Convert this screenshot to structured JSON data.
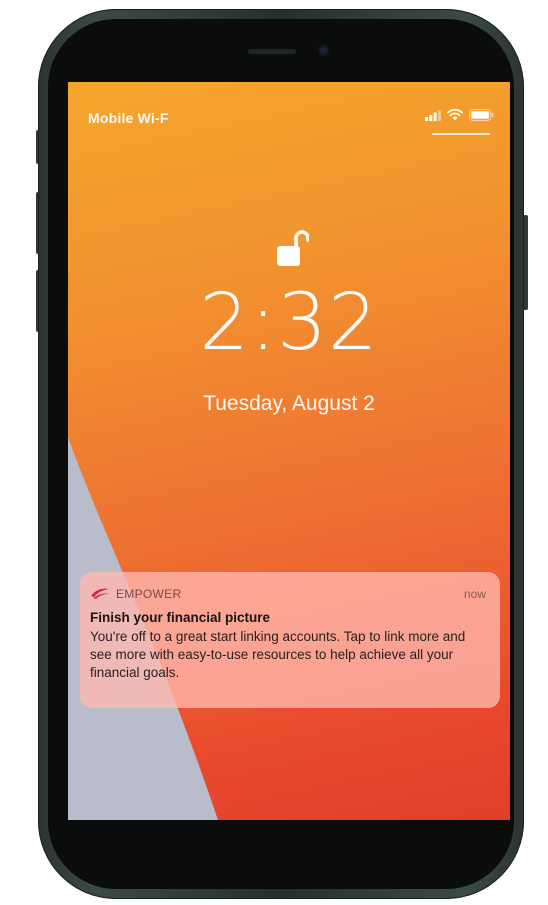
{
  "status_bar": {
    "carrier": "Mobile Wi-F"
  },
  "lock_screen": {
    "time": "2:32",
    "date": "Tuesday, August 2"
  },
  "notification": {
    "app_name": "EMPOWER",
    "timestamp": "now",
    "title": "Finish your financial picture",
    "body": "You're off to a great start linking accounts. Tap to link more and see more with easy-to-use resources to help achieve all your financial goals."
  },
  "colors": {
    "wallpaper_top": "#f4a62c",
    "wallpaper_bottom": "#e23e2a",
    "wedge": "#b9bccb",
    "notification_bg": "#ffb8b0",
    "brand": "#d2283c",
    "phone_frame": "#2b3430"
  },
  "icons": {
    "signal": "cellular-signal-icon",
    "wifi": "wifi-icon",
    "battery": "battery-icon",
    "lock": "unlocked-padlock-icon",
    "app": "empower-logo-icon"
  }
}
